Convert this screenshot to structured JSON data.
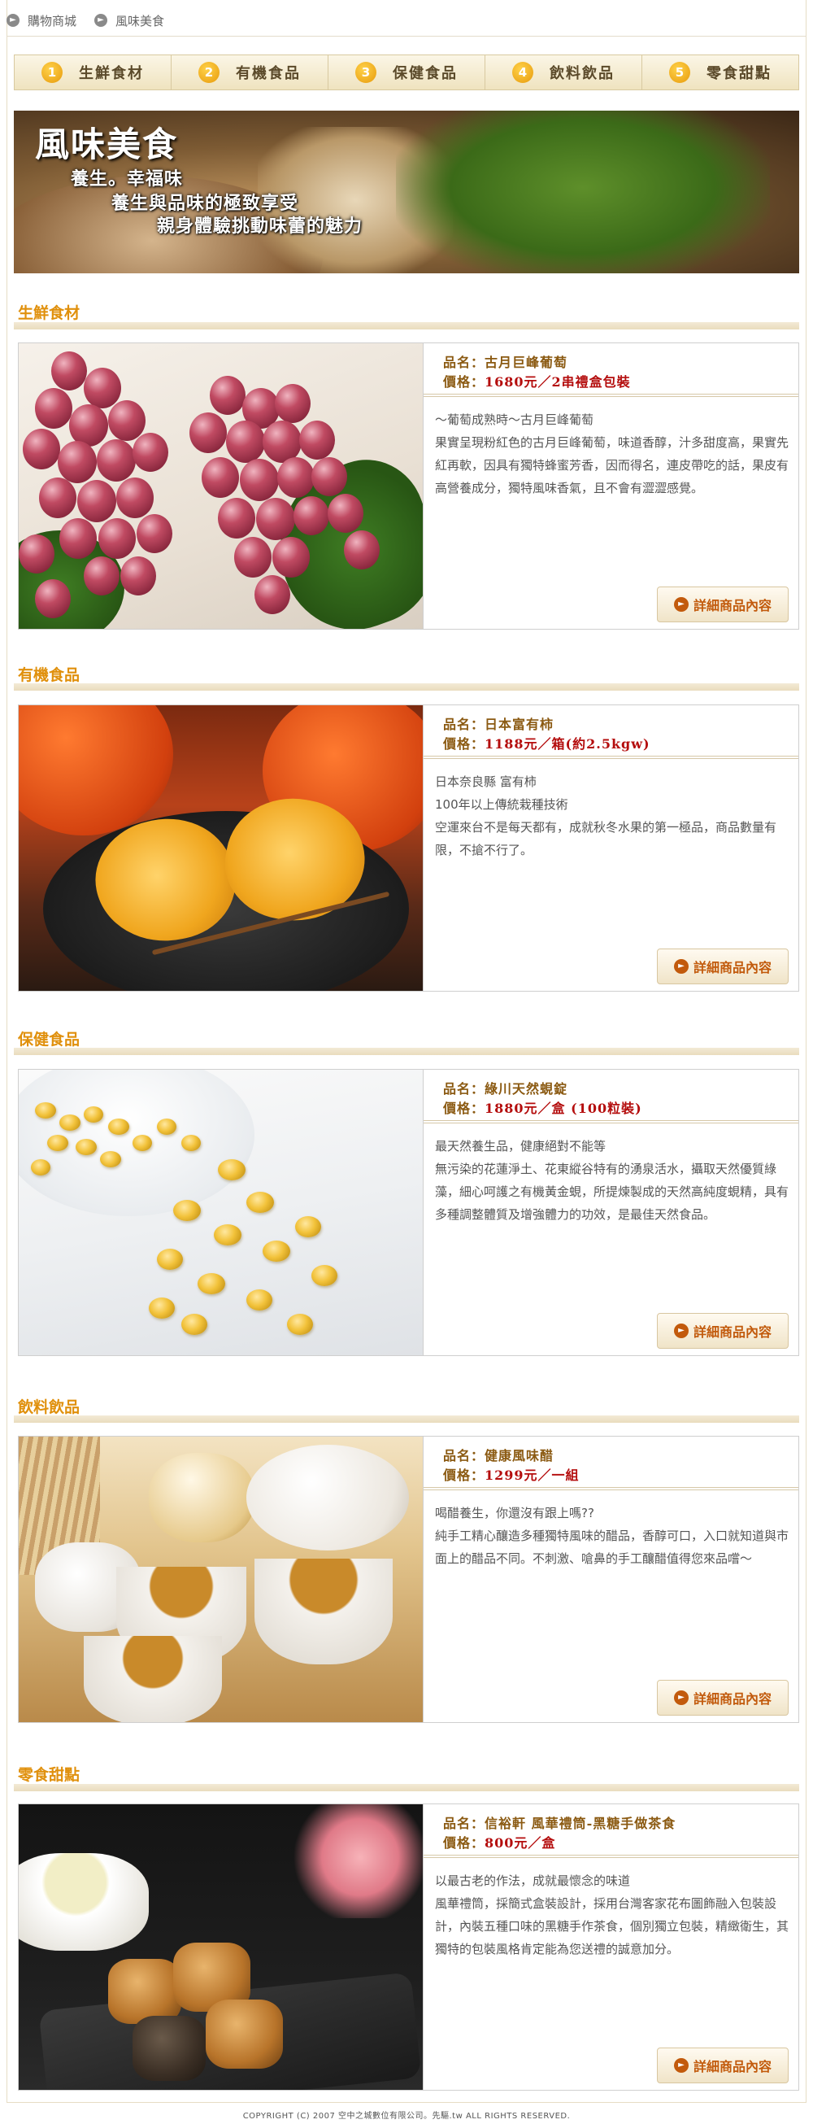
{
  "breadcrumb": [
    {
      "label": "購物商城"
    },
    {
      "label": "風味美食"
    }
  ],
  "tabs": [
    {
      "num": "1",
      "label": "生鮮食材"
    },
    {
      "num": "2",
      "label": "有機食品"
    },
    {
      "num": "3",
      "label": "保健食品"
    },
    {
      "num": "4",
      "label": "飲料飲品"
    },
    {
      "num": "5",
      "label": "零食甜點"
    }
  ],
  "banner": {
    "title": "風味美食",
    "line1": "養生。幸福味",
    "line2": "養生與品味的極致享受",
    "line3": "親身體驗挑動味蕾的魅力"
  },
  "sections": [
    {
      "title": "生鮮食材",
      "name_label": "品名：",
      "name": "古月巨峰葡萄",
      "price_label": "價格：",
      "price": "1680元／2串禮盒包裝",
      "desc": "～葡萄成熟時～古月巨峰葡萄\n果實呈現粉紅色的古月巨峰葡萄，味道香醇，汁多甜度高，果實先紅再軟，因具有獨特蜂蜜芳香，因而得名，連皮帶吃的話，果皮有高營養成分，獨特風味香氣，且不會有澀澀感覺。",
      "button": "詳細商品內容"
    },
    {
      "title": "有機食品",
      "name_label": "品名：",
      "name": "日本富有柿",
      "price_label": "價格：",
      "price": "1188元／箱(約2.5kgw)",
      "desc": "日本奈良縣 富有柿\n100年以上傳統栽種技術\n空運來台不是每天都有，成就秋冬水果的第一極品，商品數量有限，不搶不行了。",
      "button": "詳細商品內容"
    },
    {
      "title": "保健食品",
      "name_label": "品名：",
      "name": "綠川天然蜆錠",
      "price_label": "價格：",
      "price": "1880元／盒 (100粒裝)",
      "desc": "最天然養生品，健康絕對不能等\n無污染的花蓮淨土、花東縱谷特有的湧泉活水，攝取天然優質綠藻，細心呵護之有機黃金蜆，所提煉製成的天然高純度蜆精，具有多種調整體質及增強體力的功效，是最佳天然食品。",
      "button": "詳細商品內容"
    },
    {
      "title": "飲料飲品",
      "name_label": "品名：",
      "name": "健康風味醋",
      "price_label": "價格：",
      "price": "1299元／一組",
      "desc": "喝醋養生，你還沒有跟上嗎??\n純手工精心釀造多種獨特風味的醋品，香醇可口，入口就知道與市面上的醋品不同。不刺激、嗆鼻的手工釀醋值得您來品嚐～",
      "button": "詳細商品內容"
    },
    {
      "title": "零食甜點",
      "name_label": "品名：",
      "name": "信裕軒 風華禮筒-黑糖手做茶食",
      "price_label": "價格：",
      "price": "800元／盒",
      "desc": "以最古老的作法，成就最懷念的味道\n風華禮筒，採簡式盒裝設計，採用台灣客家花布圖飾融入包裝設計，內裝五種口味的黑糖手作茶食，個別獨立包裝，精緻衛生，其獨特的包裝風格肯定能為您送禮的誠意加分。",
      "button": "詳細商品內容"
    }
  ],
  "footer": "COPYRIGHT (C) 2007 空中之城數位有限公司。先驅.tw ALL RIGHTS RESERVED."
}
